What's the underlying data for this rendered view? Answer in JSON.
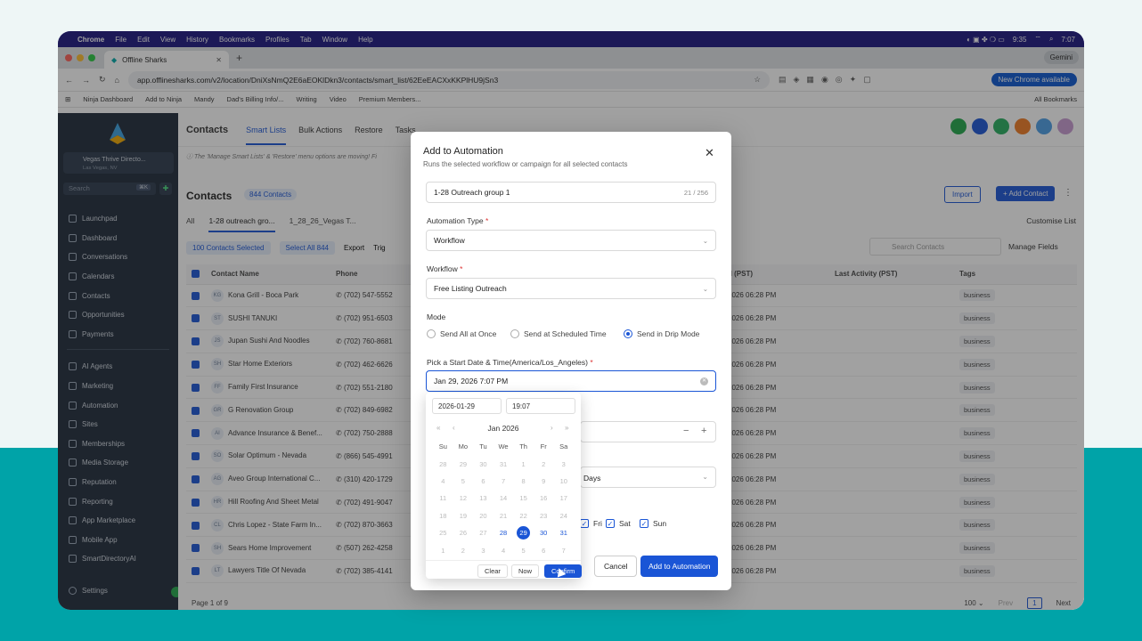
{
  "mac": {
    "app": "Chrome",
    "menus": [
      "File",
      "Edit",
      "View",
      "History",
      "Bookmarks",
      "Profiles",
      "Tab",
      "Window",
      "Help"
    ],
    "clock_a": "9:35",
    "time": "7:07"
  },
  "browser": {
    "tab_title": "Offline Sharks",
    "gemini": "Gemini",
    "url": "app.offlinesharks.com/v2/location/DniXsNmQ2E6aEOKlDkn3/contacts/smart_list/62EeEACXxKKPlHU9jSn3",
    "new_chrome": "New Chrome available",
    "bookmarks": [
      "Ninja Dashboard",
      "Add to Ninja",
      "Mandy",
      "Dad's Billing Info/...",
      "Writing",
      "Video",
      "Premium Members..."
    ],
    "all_bookmarks": "All Bookmarks"
  },
  "sidebar": {
    "location_name": "Vegas Thrive Directo...",
    "location_city": "Las Vegas, NV",
    "search_placeholder": "Search",
    "search_kbd": "⌘K",
    "items_top": [
      "Launchpad",
      "Dashboard",
      "Conversations",
      "Calendars",
      "Contacts",
      "Opportunities",
      "Payments"
    ],
    "items_bottom": [
      "AI Agents",
      "Marketing",
      "Automation",
      "Sites",
      "Memberships",
      "Media Storage",
      "Reputation",
      "Reporting",
      "App Marketplace",
      "Mobile App",
      "SmartDirectoryAI"
    ],
    "settings": "Settings"
  },
  "main": {
    "subnav": [
      "Contacts",
      "Smart Lists",
      "Bulk Actions",
      "Restore",
      "Tasks"
    ],
    "notice": "ⓘ The 'Manage Smart Lists' & 'Restore' menu options are moving! Fi",
    "title": "Contacts",
    "count": "844 Contacts",
    "import": "Import",
    "add_contact": "+ Add Contact",
    "list_tabs": [
      "All",
      "1-28 outreach gro...",
      "1_28_26_Vegas T..."
    ],
    "customise": "Customise List",
    "selected": "100 Contacts Selected",
    "select_all": "Select All 844",
    "export": "Export",
    "trigger": "Trig",
    "search_contacts": "Search Contacts",
    "manage_fields": "Manage Fields",
    "columns": [
      "Contact Name",
      "Phone",
      "d (PST)",
      "Last Activity (PST)",
      "Tags"
    ],
    "rows": [
      {
        "ini": "KG",
        "name": "Kona Grill - Boca Park",
        "phone": "(702) 547-5552",
        "date": "2026 06:28 PM",
        "tag": "business"
      },
      {
        "ini": "ST",
        "name": "SUSHI TANUKI",
        "phone": "(702) 951-6503",
        "date": "2026 06:28 PM",
        "tag": "business"
      },
      {
        "ini": "JS",
        "name": "Jupan Sushi And Noodles",
        "phone": "(702) 760-8681",
        "date": "2026 06:28 PM",
        "tag": "business"
      },
      {
        "ini": "SH",
        "name": "Star Home Exteriors",
        "phone": "(702) 462-6626",
        "date": "2026 06:28 PM",
        "tag": "business"
      },
      {
        "ini": "FF",
        "name": "Family First Insurance",
        "phone": "(702) 551-2180",
        "date": "2026 06:28 PM",
        "tag": "business"
      },
      {
        "ini": "GR",
        "name": "G Renovation Group",
        "phone": "(702) 849-6982",
        "date": "2026 06:28 PM",
        "tag": "business"
      },
      {
        "ini": "AI",
        "name": "Advance Insurance & Benef...",
        "phone": "(702) 750-2888",
        "date": "2026 06:28 PM",
        "tag": "business"
      },
      {
        "ini": "SO",
        "name": "Solar Optimum - Nevada",
        "phone": "(866) 545-4991",
        "date": "2026 06:28 PM",
        "tag": "business"
      },
      {
        "ini": "AG",
        "name": "Aveo Group International C...",
        "phone": "(310) 420-1729",
        "date": "2026 06:28 PM",
        "tag": "business"
      },
      {
        "ini": "HR",
        "name": "Hill Roofing And Sheet Metal",
        "phone": "(702) 491-9047",
        "date": "2026 06:28 PM",
        "tag": "business"
      },
      {
        "ini": "CL",
        "name": "Chris Lopez - State Farm In...",
        "phone": "(702) 870-3663",
        "date": "2026 06:28 PM",
        "tag": "business"
      },
      {
        "ini": "SH",
        "name": "Sears Home Improvement",
        "phone": "(507) 262-4258",
        "date": "2026 06:28 PM",
        "tag": "business"
      },
      {
        "ini": "LT",
        "name": "Lawyers Title Of Nevada",
        "phone": "(702) 385-4141",
        "date": "2026 06:28 PM",
        "tag": "business"
      }
    ],
    "page_of": "Page 1 of 9",
    "per_page": "100 ⌄",
    "prev": "Prev",
    "page": "1",
    "next": "Next"
  },
  "modal": {
    "title": "Add to Automation",
    "subtitle": "Runs the selected workflow or campaign for all selected contacts",
    "name_value": "1-28 Outreach group 1",
    "name_count": "21 / 256",
    "automation_type_label": "Automation Type",
    "automation_type_value": "Workflow",
    "workflow_label": "Workflow",
    "workflow_value": "Free Listing Outreach",
    "mode_label": "Mode",
    "mode_options": [
      "Send All at Once",
      "Send at Scheduled Time",
      "Send in Drip Mode"
    ],
    "start_label": "Pick a Start Date & Time(America/Los_Angeles)",
    "start_value": "Jan 29, 2026 7:07 PM",
    "days_value": "Days",
    "days": [
      "Fri",
      "Sat",
      "Sun"
    ],
    "cancel": "Cancel",
    "add": "Add to Automation",
    "required": "*"
  },
  "picker": {
    "date": "2026-01-29",
    "time": "19:07",
    "month": "Jan 2026",
    "weekdays": [
      "Su",
      "Mo",
      "Tu",
      "We",
      "Th",
      "Fr",
      "Sa"
    ],
    "weeks": [
      [
        "28",
        "29",
        "30",
        "31",
        "1",
        "2",
        "3"
      ],
      [
        "4",
        "5",
        "6",
        "7",
        "8",
        "9",
        "10"
      ],
      [
        "11",
        "12",
        "13",
        "14",
        "15",
        "16",
        "17"
      ],
      [
        "18",
        "19",
        "20",
        "21",
        "22",
        "23",
        "24"
      ],
      [
        "25",
        "26",
        "27",
        "28",
        "29",
        "30",
        "31"
      ],
      [
        "1",
        "2",
        "3",
        "4",
        "5",
        "6",
        "7"
      ]
    ],
    "selected_day": "29",
    "clear": "Clear",
    "now": "Now",
    "confirm": "Confirm"
  },
  "colors": {
    "accent": "#1a55d6",
    "sidebar": "#1e2a3a",
    "menubar": "#1a1580",
    "teal": "#00a3a8"
  }
}
